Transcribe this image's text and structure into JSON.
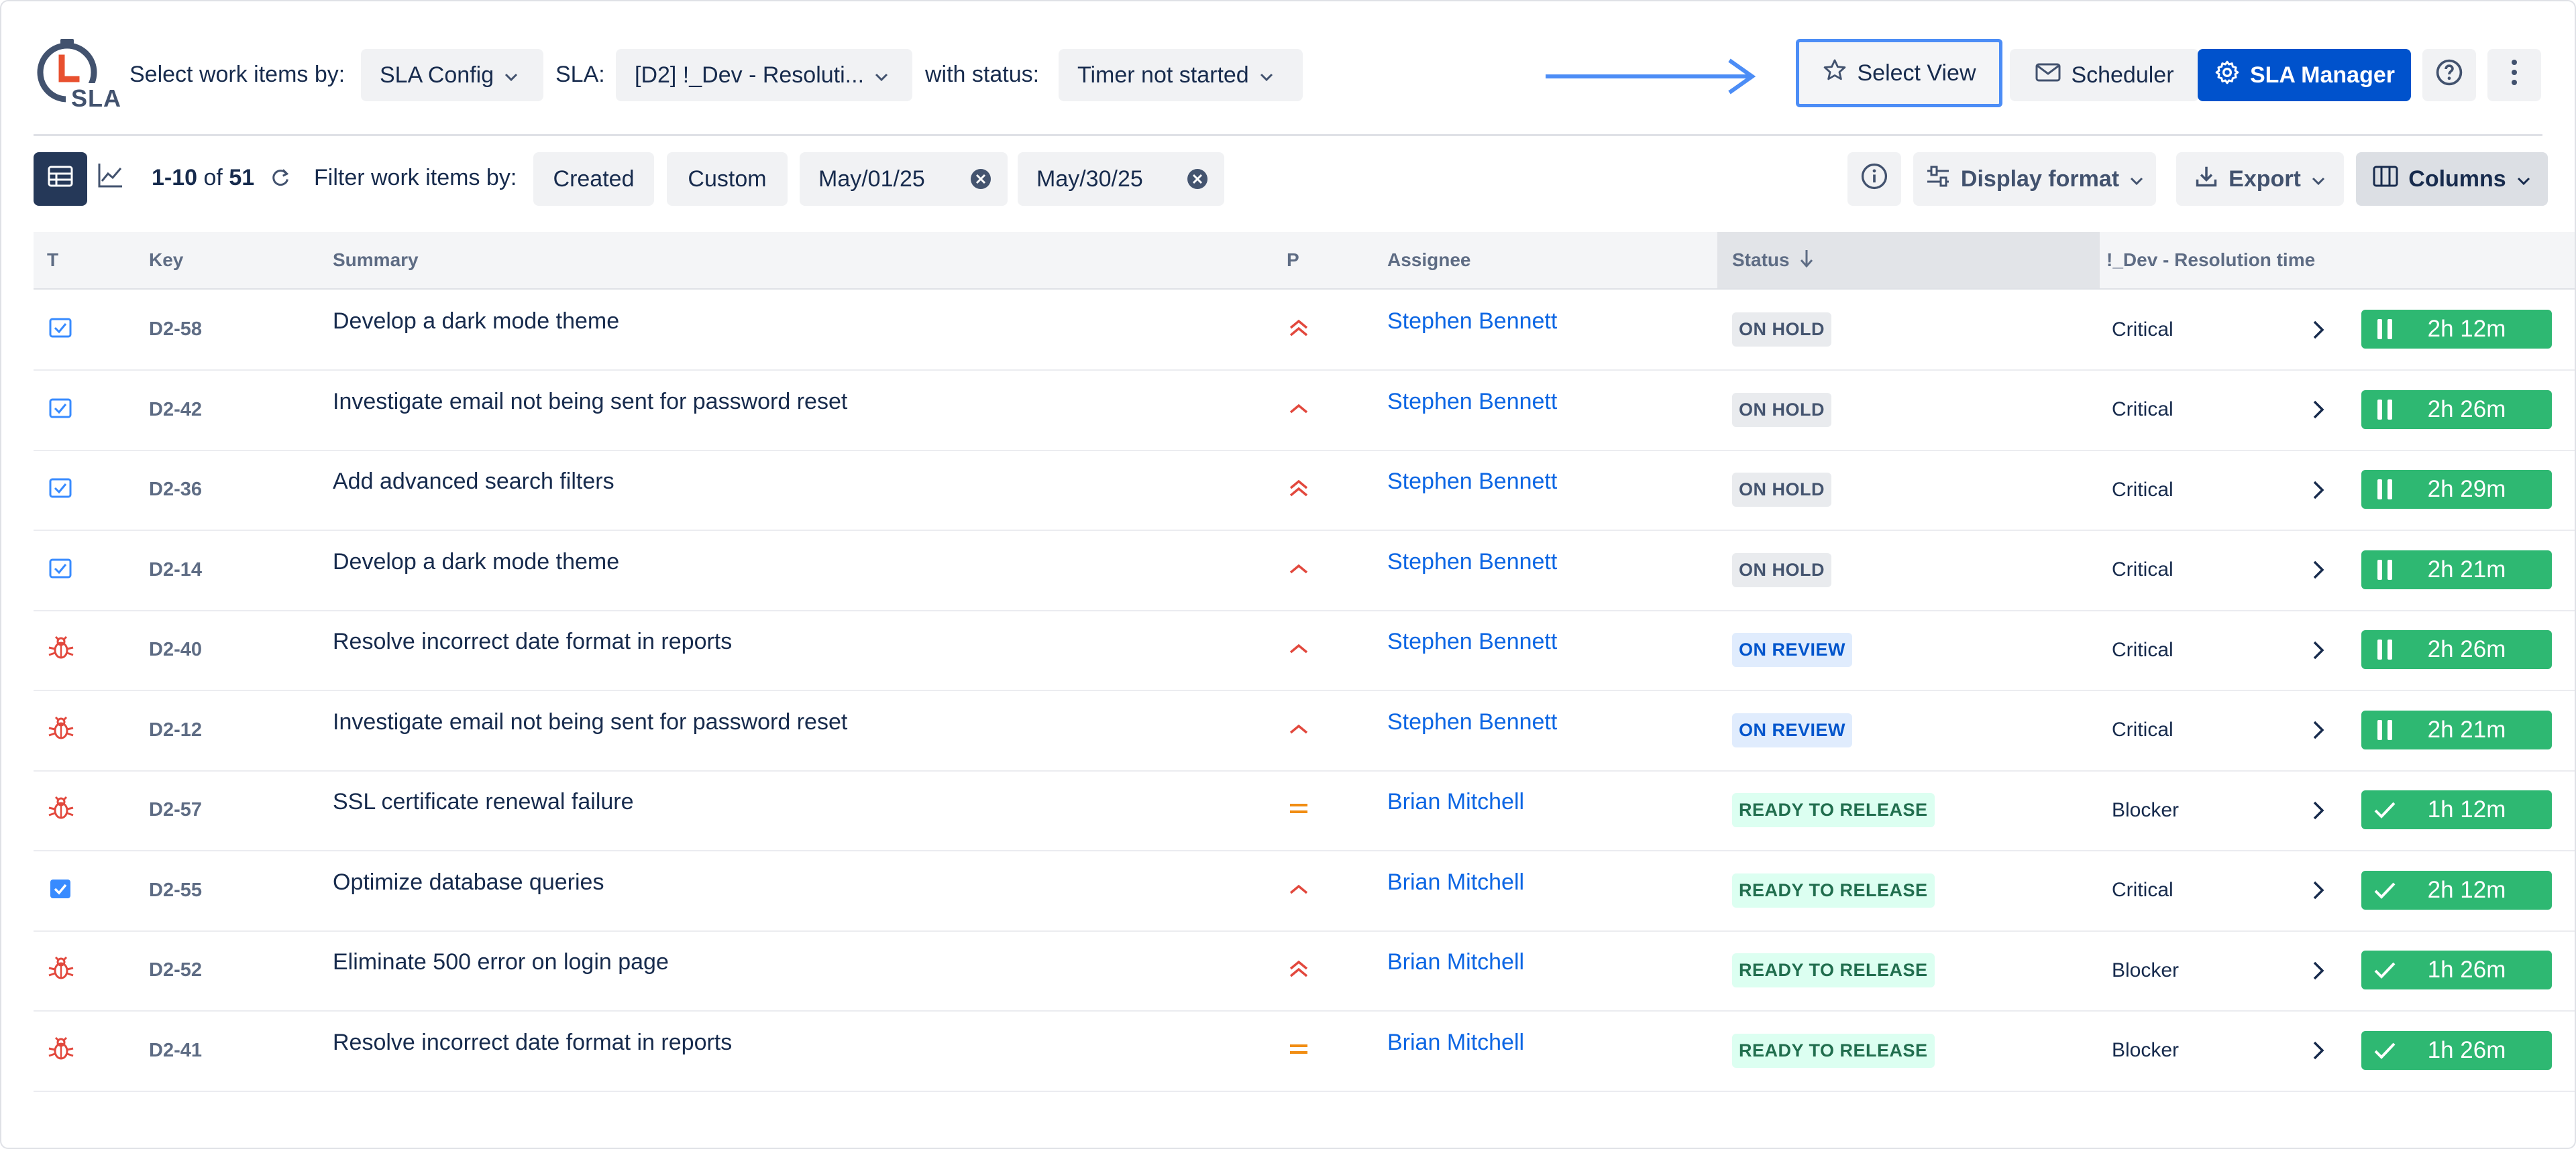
{
  "app": {
    "logo_text": "SLA"
  },
  "header": {
    "select_by_label": "Select work items by:",
    "config_value": "SLA Config",
    "sla_label": "SLA:",
    "sla_value": "[D2] !_Dev - Resoluti...",
    "status_label": "with status:",
    "status_value": "Timer not started",
    "select_view": "Select View",
    "scheduler": "Scheduler",
    "sla_manager": "SLA Manager",
    "accent": "#0052cc",
    "highlight": "#4c8df6"
  },
  "toolbar": {
    "range_start": "1-10",
    "range_of": "of",
    "total": "51",
    "filter_label": "Filter work items by:",
    "created": "Created",
    "custom": "Custom",
    "date_from": "May/01/25",
    "date_to": "May/30/25",
    "display_format": "Display format",
    "export": "Export",
    "columns": "Columns"
  },
  "table": {
    "columns": [
      "T",
      "Key",
      "Summary",
      "P",
      "Assignee",
      "Status",
      "!_Dev - Resolution time"
    ],
    "rows": [
      {
        "type": "task",
        "key": "D2-58",
        "summary": "Develop a dark mode theme",
        "priority": "highest",
        "assignee": "Stephen Bennett",
        "status": "ON HOLD",
        "status_kind": "hold",
        "level": "Critical",
        "timer_state": "paused",
        "timer": "2h 12m"
      },
      {
        "type": "task",
        "key": "D2-42",
        "summary": "Investigate email not being sent for password reset",
        "priority": "high",
        "assignee": "Stephen Bennett",
        "status": "ON HOLD",
        "status_kind": "hold",
        "level": "Critical",
        "timer_state": "paused",
        "timer": "2h 26m"
      },
      {
        "type": "task",
        "key": "D2-36",
        "summary": "Add advanced search filters",
        "priority": "highest",
        "assignee": "Stephen Bennett",
        "status": "ON HOLD",
        "status_kind": "hold",
        "level": "Critical",
        "timer_state": "paused",
        "timer": "2h 29m"
      },
      {
        "type": "task",
        "key": "D2-14",
        "summary": "Develop a dark mode theme",
        "priority": "high",
        "assignee": "Stephen Bennett",
        "status": "ON HOLD",
        "status_kind": "hold",
        "level": "Critical",
        "timer_state": "paused",
        "timer": "2h 21m"
      },
      {
        "type": "bug",
        "key": "D2-40",
        "summary": "Resolve incorrect date format in reports",
        "priority": "high",
        "assignee": "Stephen Bennett",
        "status": "ON REVIEW",
        "status_kind": "review",
        "level": "Critical",
        "timer_state": "paused",
        "timer": "2h 26m"
      },
      {
        "type": "bug",
        "key": "D2-12",
        "summary": "Investigate email not being sent for password reset",
        "priority": "high",
        "assignee": "Stephen Bennett",
        "status": "ON REVIEW",
        "status_kind": "review",
        "level": "Critical",
        "timer_state": "paused",
        "timer": "2h 21m"
      },
      {
        "type": "bug",
        "key": "D2-57",
        "summary": "SSL certificate renewal failure",
        "priority": "medium",
        "assignee": "Brian Mitchell",
        "status": "READY TO RELEASE",
        "status_kind": "release",
        "level": "Blocker",
        "timer_state": "done",
        "timer": "1h 12m"
      },
      {
        "type": "task-filled",
        "key": "D2-55",
        "summary": "Optimize database queries",
        "priority": "high",
        "assignee": "Brian Mitchell",
        "status": "READY TO RELEASE",
        "status_kind": "release",
        "level": "Critical",
        "timer_state": "done",
        "timer": "2h 12m"
      },
      {
        "type": "bug",
        "key": "D2-52",
        "summary": "Eliminate 500 error on login page",
        "priority": "highest",
        "assignee": "Brian Mitchell",
        "status": "READY TO RELEASE",
        "status_kind": "release",
        "level": "Blocker",
        "timer_state": "done",
        "timer": "1h 26m"
      },
      {
        "type": "bug",
        "key": "D2-41",
        "summary": "Resolve incorrect date format in reports",
        "priority": "medium",
        "assignee": "Brian Mitchell",
        "status": "READY TO RELEASE",
        "status_kind": "release",
        "level": "Blocker",
        "timer_state": "done",
        "timer": "1h 26m"
      }
    ]
  },
  "colors": {
    "hold_bg": "#e9ebee",
    "hold_fg": "#44546f",
    "review_bg": "#e0ecfd",
    "review_fg": "#0055cc",
    "release_bg": "#dcfff1",
    "release_fg": "#216e4e",
    "timer_green": "#2eb872",
    "priority_red": "#e2483d",
    "priority_orange": "#f18d13",
    "bug_red": "#e2483d",
    "task_blue": "#388bff"
  }
}
